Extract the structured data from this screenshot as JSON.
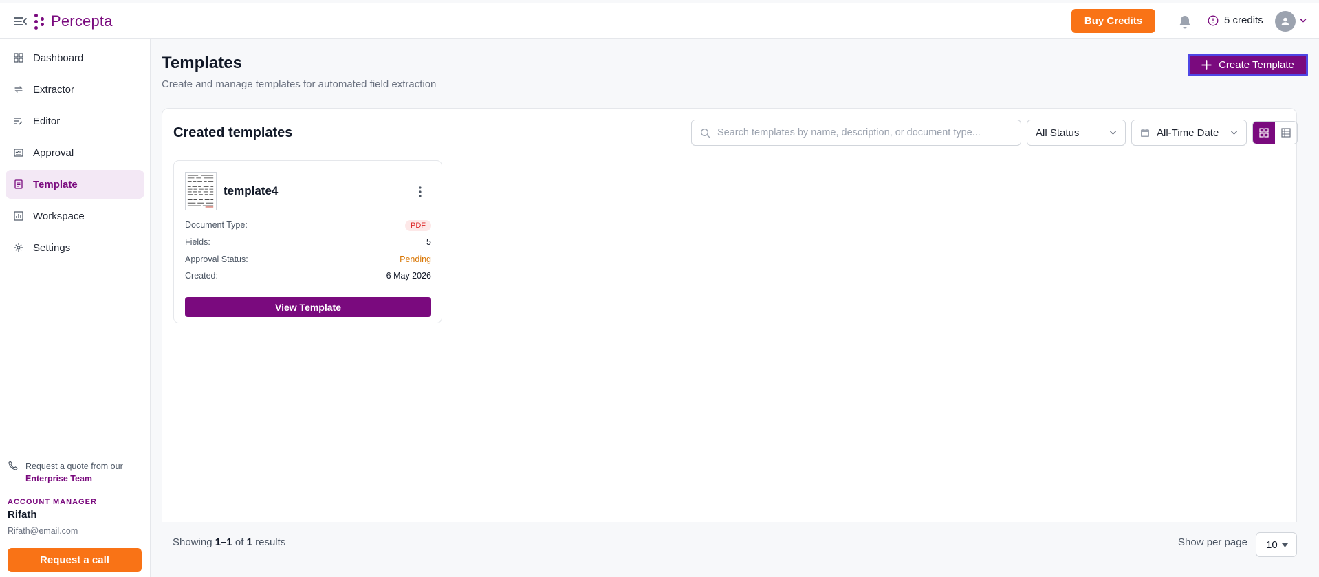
{
  "app": {
    "name": "Percepta",
    "brand_color": "#7a0a7e",
    "accent_color": "#f97316"
  },
  "topbar": {
    "buy_credits_label": "Buy Credits",
    "credits_label": "5 credits"
  },
  "sidebar": {
    "items": [
      {
        "label": "Dashboard",
        "icon": "grid-icon"
      },
      {
        "label": "Extractor",
        "icon": "arrows-icon"
      },
      {
        "label": "Editor",
        "icon": "edit-lines-icon"
      },
      {
        "label": "Approval",
        "icon": "approval-icon"
      },
      {
        "label": "Template",
        "icon": "document-icon",
        "active": true
      },
      {
        "label": "Workspace",
        "icon": "chart-icon"
      },
      {
        "label": "Settings",
        "icon": "gear-icon"
      }
    ],
    "quote_text": "Request a quote from our",
    "quote_link": "Enterprise Team",
    "account_manager_label": "ACCOUNT MANAGER",
    "account_manager_name": "Rifath",
    "account_manager_email": "Rifath@email.com",
    "request_call_label": "Request a call"
  },
  "main": {
    "title": "Templates",
    "subtitle": "Create and manage templates for automated field extraction",
    "create_button_label": "Create Template",
    "panel_title": "Created templates",
    "search_placeholder": "Search templates by name, description, or document type...",
    "status_filter": "All Status",
    "date_filter": "All-Time Date",
    "templates": [
      {
        "name": "template4",
        "document_type_label": "Document Type:",
        "document_type": "PDF",
        "fields_label": "Fields:",
        "fields": "5",
        "approval_label": "Approval Status:",
        "approval_status": "Pending",
        "created_label": "Created:",
        "created": "6 May 2026",
        "view_label": "View Template"
      }
    ]
  },
  "footer": {
    "showing_prefix": "Showing",
    "showing_range": "1–1",
    "showing_of": "of",
    "showing_total": "1",
    "showing_suffix": "results",
    "per_page_label": "Show per page",
    "per_page_value": "10"
  }
}
